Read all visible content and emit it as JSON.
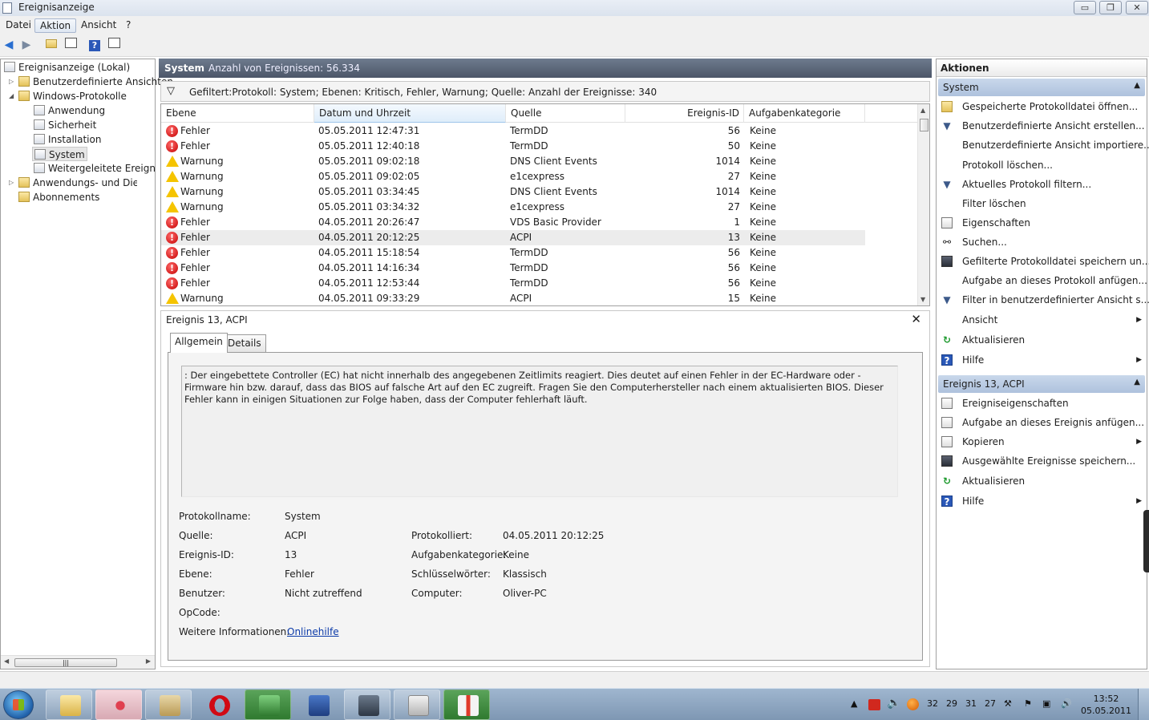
{
  "window": {
    "title": "Ereignisanzeige",
    "min": "▭",
    "max": "❐",
    "close": "✕"
  },
  "menu": [
    "Datei",
    "Aktion",
    "Ansicht",
    "?"
  ],
  "tree": {
    "root": "Ereignisanzeige (Lokal)",
    "custom_views": "Benutzerdefinierte Ansichten",
    "windows_logs": "Windows-Protokolle",
    "logs": [
      "Anwendung",
      "Sicherheit",
      "Installation",
      "System",
      "Weitergeleitete Ereignisse"
    ],
    "app_services": "Anwendungs- und Dienstprotokolle",
    "subscriptions": "Abonnements"
  },
  "center": {
    "title": "System",
    "count_label": "Anzahl von Ereignissen: 56.334",
    "filter_text": "Gefiltert:Protokoll: System; Ebenen: Kritisch, Fehler, Warnung; Quelle:  Anzahl der Ereignisse: 340",
    "columns": [
      "Ebene",
      "Datum und Uhrzeit",
      "Quelle",
      "Ereignis-ID",
      "Aufgabenkategorie"
    ],
    "rows": [
      {
        "level": "Fehler",
        "type": "err",
        "date": "05.05.2011 12:47:31",
        "source": "TermDD",
        "id": "56",
        "cat": "Keine"
      },
      {
        "level": "Fehler",
        "type": "err",
        "date": "05.05.2011 12:40:18",
        "source": "TermDD",
        "id": "50",
        "cat": "Keine"
      },
      {
        "level": "Warnung",
        "type": "warn",
        "date": "05.05.2011 09:02:18",
        "source": "DNS Client Events",
        "id": "1014",
        "cat": "Keine"
      },
      {
        "level": "Warnung",
        "type": "warn",
        "date": "05.05.2011 09:02:05",
        "source": "e1cexpress",
        "id": "27",
        "cat": "Keine"
      },
      {
        "level": "Warnung",
        "type": "warn",
        "date": "05.05.2011 03:34:45",
        "source": "DNS Client Events",
        "id": "1014",
        "cat": "Keine"
      },
      {
        "level": "Warnung",
        "type": "warn",
        "date": "05.05.2011 03:34:32",
        "source": "e1cexpress",
        "id": "27",
        "cat": "Keine"
      },
      {
        "level": "Fehler",
        "type": "err",
        "date": "04.05.2011 20:26:47",
        "source": "VDS Basic Provider",
        "id": "1",
        "cat": "Keine"
      },
      {
        "level": "Fehler",
        "type": "err",
        "date": "04.05.2011 20:12:25",
        "source": "ACPI",
        "id": "13",
        "cat": "Keine"
      },
      {
        "level": "Fehler",
        "type": "err",
        "date": "04.05.2011 15:18:54",
        "source": "TermDD",
        "id": "56",
        "cat": "Keine"
      },
      {
        "level": "Fehler",
        "type": "err",
        "date": "04.05.2011 14:16:34",
        "source": "TermDD",
        "id": "56",
        "cat": "Keine"
      },
      {
        "level": "Fehler",
        "type": "err",
        "date": "04.05.2011 12:53:44",
        "source": "TermDD",
        "id": "56",
        "cat": "Keine"
      },
      {
        "level": "Warnung",
        "type": "warn",
        "date": "04.05.2011 09:33:29",
        "source": "ACPI",
        "id": "15",
        "cat": "Keine"
      }
    ],
    "selected_row": 7
  },
  "details": {
    "title": "Ereignis 13, ACPI",
    "close": "✕",
    "tabs": [
      "Allgemein",
      "Details"
    ],
    "description": ": Der eingebettete Controller (EC) hat nicht innerhalb des angegebenen Zeitlimits reagiert. Dies deutet auf einen Fehler in der EC-Hardware oder -Firmware hin bzw. darauf, dass das BIOS auf falsche Art auf den EC zugreift. Fragen Sie den Computerhersteller nach einem aktualisierten BIOS. Dieser Fehler kann in einigen Situationen zur Folge haben, dass der Computer fehlerhaft läuft.",
    "labels": {
      "log_name": "Protokollname:",
      "source": "Quelle:",
      "event_id": "Ereignis-ID:",
      "level": "Ebene:",
      "user": "Benutzer:",
      "opcode": "OpCode:",
      "more_info": "Weitere Informationen:",
      "logged": "Protokolliert:",
      "task_cat": "Aufgabenkategorie:",
      "keywords": "Schlüsselwörter:",
      "computer": "Computer:"
    },
    "values": {
      "log_name": "System",
      "source": "ACPI",
      "event_id": "13",
      "level": "Fehler",
      "user": "Nicht zutreffend",
      "opcode": "",
      "more_info": "Onlinehilfe",
      "logged": "04.05.2011 20:12:25",
      "task_cat": "Keine",
      "keywords": "Klassisch",
      "computer": "Oliver-PC"
    }
  },
  "actions": {
    "header": "Aktionen",
    "section1": "System",
    "items1": [
      {
        "label": "Gespeicherte Protokolldatei öffnen...",
        "icon": "folder-open-icon",
        "sub": ""
      },
      {
        "label": "Benutzerdefinierte Ansicht erstellen...",
        "icon": "funnel-create-icon",
        "sub": ""
      },
      {
        "label": "Benutzerdefinierte Ansicht importiere...",
        "icon": "",
        "sub": ""
      },
      {
        "label": "Protokoll löschen...",
        "icon": "",
        "sub": ""
      },
      {
        "label": "Aktuelles Protokoll filtern...",
        "icon": "funnel-icon",
        "sub": ""
      },
      {
        "label": "Filter löschen",
        "icon": "",
        "sub": ""
      },
      {
        "label": "Eigenschaften",
        "icon": "properties-icon",
        "sub": ""
      },
      {
        "label": "Suchen...",
        "icon": "binoculars-icon",
        "sub": ""
      },
      {
        "label": "Gefilterte Protokolldatei speichern un...",
        "icon": "save-icon",
        "sub": ""
      },
      {
        "label": "Aufgabe an dieses Protokoll anfügen...",
        "icon": "",
        "sub": ""
      },
      {
        "label": "Filter in benutzerdefinierter Ansicht s...",
        "icon": "funnel-save-icon",
        "sub": ""
      },
      {
        "label": "Ansicht",
        "icon": "",
        "sub": "▶"
      },
      {
        "label": "Aktualisieren",
        "icon": "refresh-icon",
        "sub": ""
      },
      {
        "label": "Hilfe",
        "icon": "help-icon",
        "sub": "▶"
      }
    ],
    "section2": "Ereignis 13, ACPI",
    "items2": [
      {
        "label": "Ereigniseigenschaften",
        "icon": "properties-icon",
        "sub": ""
      },
      {
        "label": "Aufgabe an dieses Ereignis anfügen...",
        "icon": "task-icon",
        "sub": ""
      },
      {
        "label": "Kopieren",
        "icon": "copy-icon",
        "sub": "▶"
      },
      {
        "label": "Ausgewählte Ereignisse speichern...",
        "icon": "save-icon",
        "sub": ""
      },
      {
        "label": "Aktualisieren",
        "icon": "refresh-icon",
        "sub": ""
      },
      {
        "label": "Hilfe",
        "icon": "help-icon",
        "sub": "▶"
      }
    ]
  },
  "taskbar": {
    "tray_numbers": [
      "32",
      "29",
      "31",
      "27"
    ],
    "time": "13:52",
    "date": "05.05.2011"
  }
}
